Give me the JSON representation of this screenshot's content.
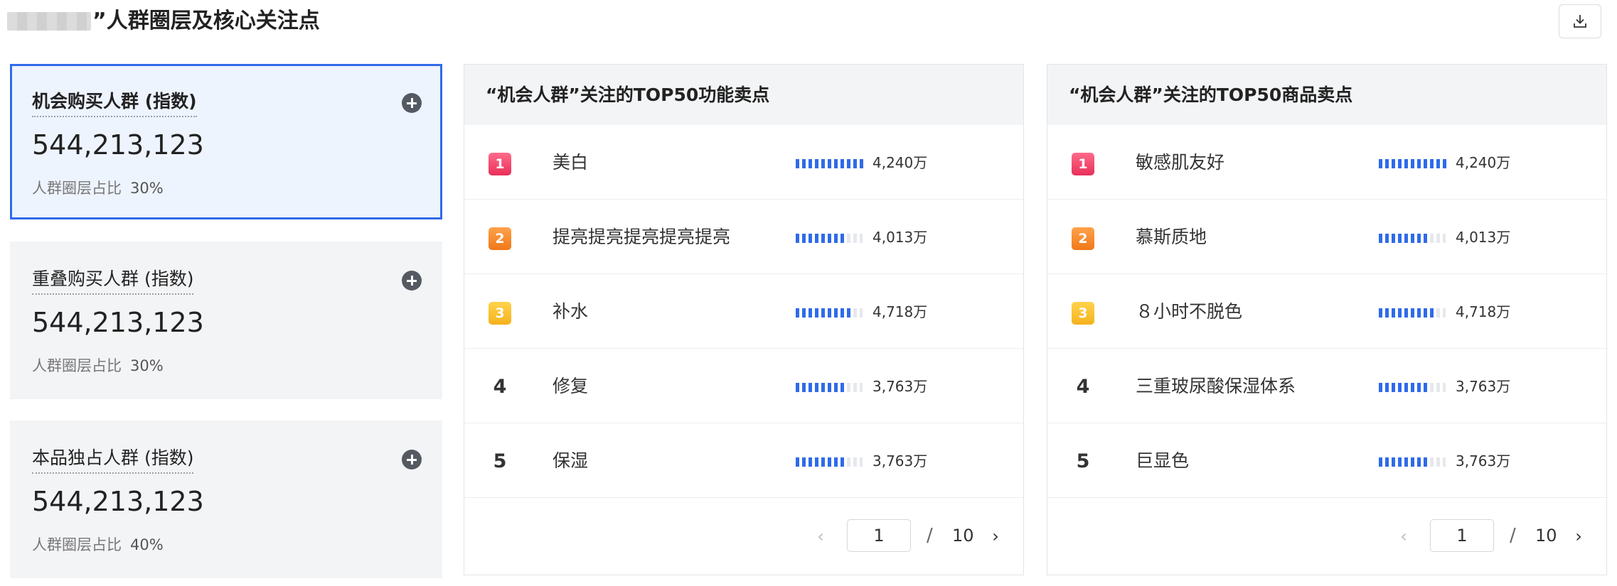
{
  "header": {
    "title": "”人群圈层及核心关注点",
    "download_icon": "download-icon"
  },
  "segments": [
    {
      "name": "机会购买人群 (指数)",
      "value": "544,213,123",
      "share_label": "人群圈层占比",
      "share_value": "30%",
      "active": true
    },
    {
      "name": "重叠购买人群 (指数)",
      "value": "544,213,123",
      "share_label": "人群圈层占比",
      "share_value": "30%",
      "active": false
    },
    {
      "name": "本品独占人群 (指数)",
      "value": "544,213,123",
      "share_label": "人群圈层占比",
      "share_value": "40%",
      "active": false
    }
  ],
  "panels": [
    {
      "title": "“机会人群”关注的TOP50功能卖点",
      "rows": [
        {
          "rank": "1",
          "name": "美白",
          "value": "4,240万",
          "level": 1.0
        },
        {
          "rank": "2",
          "name": "提亮提亮提亮提亮提亮",
          "value": "4,013万",
          "level": 0.73
        },
        {
          "rank": "3",
          "name": "补水",
          "value": "4,718万",
          "level": 0.82
        },
        {
          "rank": "4",
          "name": "修复",
          "value": "3,763万",
          "level": 0.73
        },
        {
          "rank": "5",
          "name": "保湿",
          "value": "3,763万",
          "level": 0.73
        }
      ],
      "pager": {
        "current": "1",
        "separator": "/",
        "total": "10",
        "prev": "‹",
        "next": "›"
      }
    },
    {
      "title": "“机会人群”关注的TOP50商品卖点",
      "rows": [
        {
          "rank": "1",
          "name": "敏感肌友好",
          "value": "4,240万",
          "level": 1.0
        },
        {
          "rank": "2",
          "name": "慕斯质地",
          "value": "4,013万",
          "level": 0.73
        },
        {
          "rank": "3",
          "name": "８小时不脱色",
          "value": "4,718万",
          "level": 0.82
        },
        {
          "rank": "4",
          "name": "三重玻尿酸保湿体系",
          "value": "3,763万",
          "level": 0.73
        },
        {
          "rank": "5",
          "name": "巨显色",
          "value": "3,763万",
          "level": 0.73
        }
      ],
      "pager": {
        "current": "1",
        "separator": "/",
        "total": "10",
        "prev": "‹",
        "next": "›"
      }
    }
  ],
  "colors": {
    "accent": "#2f6bea",
    "active_card_bg": "#eef4fe",
    "card_bg": "#f3f4f6",
    "rank1": "#e8305a",
    "rank2": "#f07818",
    "rank3": "#f5b21d"
  }
}
